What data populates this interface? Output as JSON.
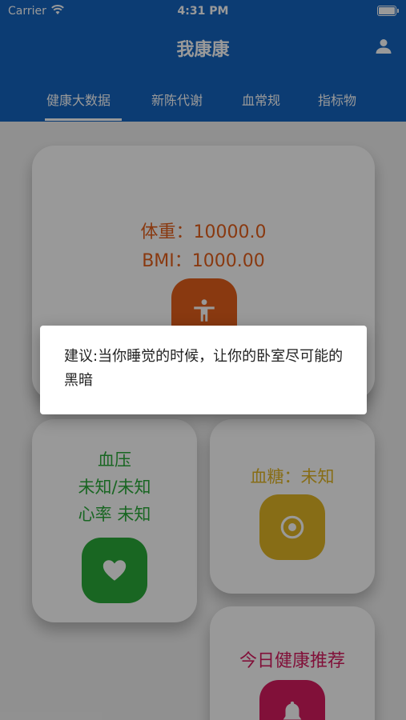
{
  "status_bar": {
    "carrier": "Carrier",
    "time": "4:31 PM"
  },
  "app_bar": {
    "title": "我康康"
  },
  "tabs": [
    {
      "label": "健康大数据",
      "selected": true
    },
    {
      "label": "新陈代谢",
      "selected": false
    },
    {
      "label": "血常规",
      "selected": false
    },
    {
      "label": "指标物",
      "selected": false
    }
  ],
  "cards": {
    "weight": {
      "weight_text": "体重：10000.0",
      "bmi_text": "BMI：1000.00",
      "color": "#e5601b",
      "icon": "person-icon"
    },
    "blood_pressure": {
      "title": "血压",
      "value_text": "未知/未知",
      "heart_rate_text": "心率 未知",
      "color": "#2aaa3a",
      "icon": "heart-icon"
    },
    "blood_sugar": {
      "text": "血糖：未知",
      "color": "#e2b626",
      "icon": "target-icon"
    },
    "recommendation": {
      "title": "今日健康推荐",
      "color": "#d81b60",
      "icon": "bell-icon"
    }
  },
  "dialog": {
    "message": "建议:当你睡觉的时候，让你的卧室尽可能的黑暗"
  },
  "colors": {
    "primary": "#1565c0",
    "background": "#f1f1f1"
  }
}
